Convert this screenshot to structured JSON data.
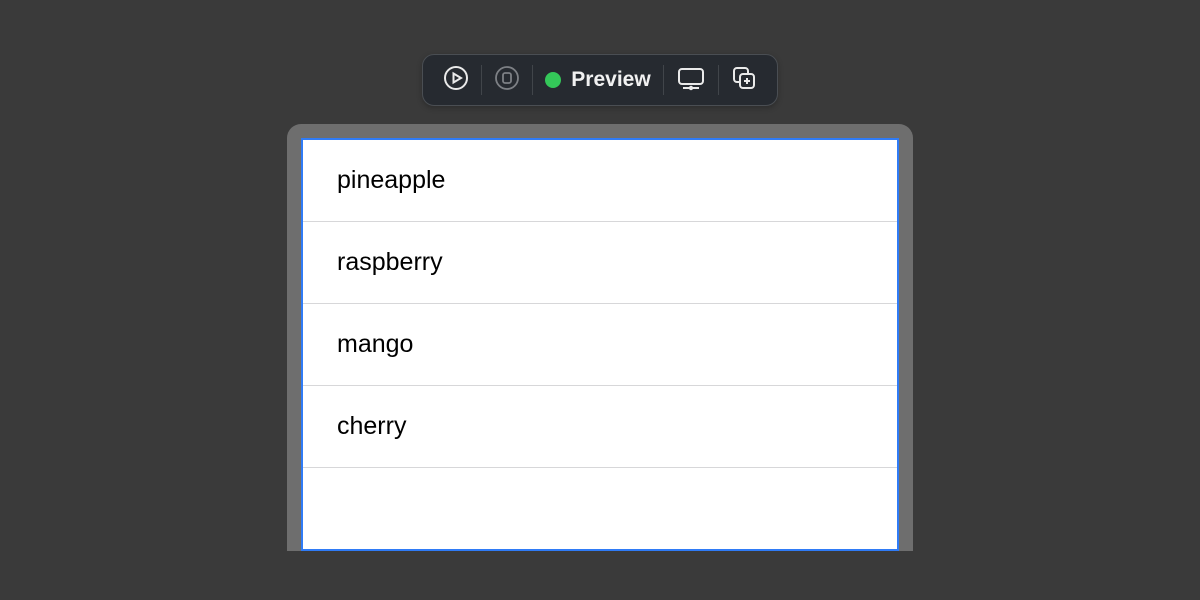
{
  "toolbar": {
    "status": "running",
    "preview_label": "Preview"
  },
  "list": {
    "items": [
      {
        "label": "pineapple"
      },
      {
        "label": "raspberry"
      },
      {
        "label": "mango"
      },
      {
        "label": "cherry"
      }
    ]
  }
}
